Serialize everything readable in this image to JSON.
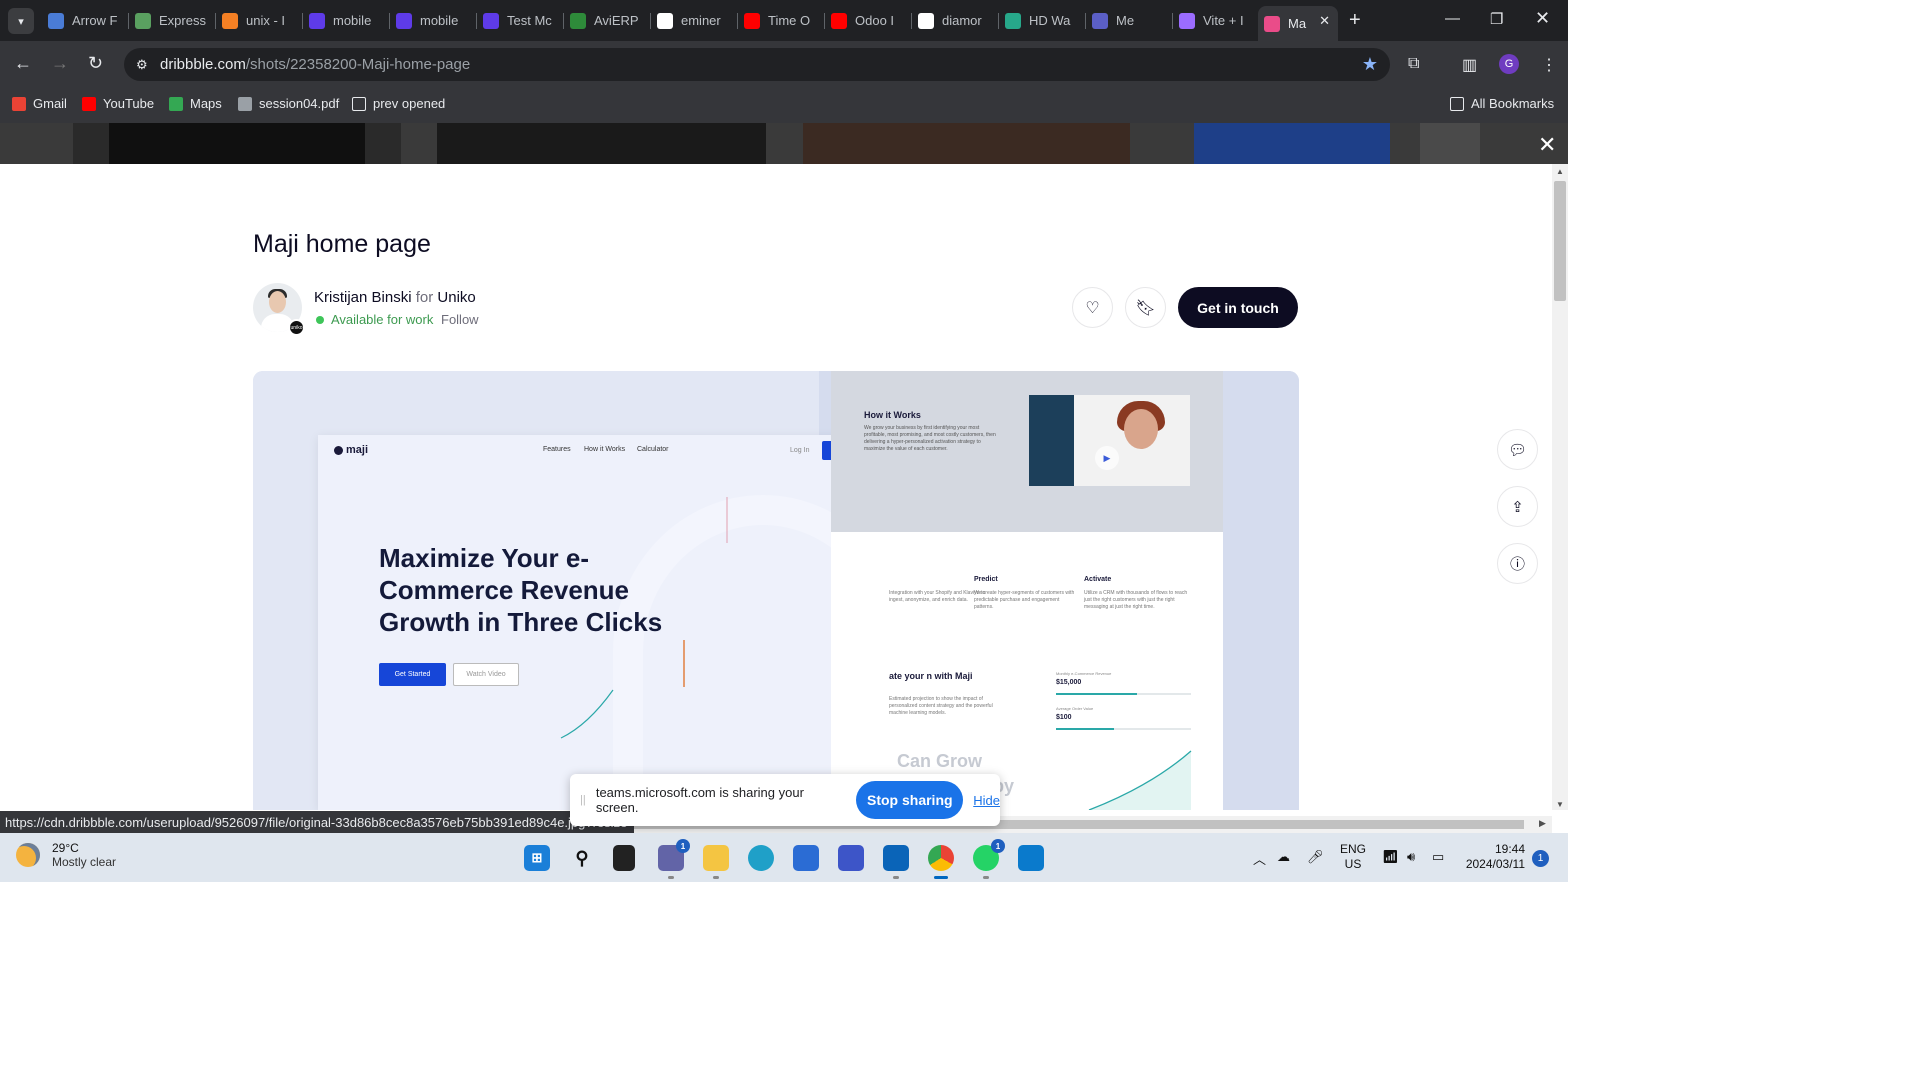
{
  "tabs": [
    {
      "title": "Arrow F",
      "color": "#4a7cd6"
    },
    {
      "title": "Express",
      "color": "#5aa060"
    },
    {
      "title": "unix - I",
      "color": "#f48024"
    },
    {
      "title": "mobile",
      "color": "#5e3be8"
    },
    {
      "title": "mobile",
      "color": "#5e3be8"
    },
    {
      "title": "Test Mc",
      "color": "#5e3be8"
    },
    {
      "title": "AviERP",
      "color": "#2e8b3a"
    },
    {
      "title": "eminer",
      "color": "#ffffff"
    },
    {
      "title": "Time O",
      "color": "#ff0000"
    },
    {
      "title": "Odoo I",
      "color": "#ff0000"
    },
    {
      "title": "diamor",
      "color": "#ffffff"
    },
    {
      "title": "HD Wa",
      "color": "#27a88a"
    },
    {
      "title": "Me",
      "color": "#5b5fc7"
    },
    {
      "title": "Vite + I",
      "color": "#9b6cff"
    },
    {
      "title": "Ma",
      "color": "#ea4c89"
    }
  ],
  "browser": {
    "url_host": "dribbble.com",
    "url_path": "/shots/22358200-Maji-home-page",
    "profile_initial": "G"
  },
  "bookmarks": [
    {
      "label": "Gmail",
      "color": "#ea4335"
    },
    {
      "label": "YouTube",
      "color": "#ff0000"
    },
    {
      "label": "Maps",
      "color": "#34a853"
    },
    {
      "label": "session04.pdf",
      "color": "#9aa0a6"
    },
    {
      "label": "prev opened",
      "color": "transparent"
    }
  ],
  "all_bookmarks": "All Bookmarks",
  "shot": {
    "title": "Maji home page",
    "author": "Kristijan Binski",
    "for_word": "for",
    "team": "Uniko",
    "availability": "Available for work",
    "follow": "Follow",
    "cta": "Get in touch",
    "avatar_badge": "uniko"
  },
  "mock": {
    "logo": "maji",
    "nav": [
      "Features",
      "How it Works",
      "Calculator"
    ],
    "login": "Log In",
    "get_started": "Get Started",
    "hero": "Maximize Your e-Commerce Revenue Growth in Three Clicks",
    "watch_video": "Watch Video",
    "how_title": "How it Works",
    "how_text": "We grow your business by first identifying your most profitable, most promising, and most costly customers, then delivering a hyper-personalized activation strategy to maximize the value of each customer.",
    "col1_text": "Integration with your Shopify and Klaviyo to ingest, anonymize, and enrich data.",
    "col2_title": "Predict",
    "col2_text": "We create hyper-segments of customers with predictable purchase and engagement patterns.",
    "col3_title": "Activate",
    "col3_text": "Utilize a CRM with thousands of flows to reach just the right customers with just the right messaging at just the right time.",
    "calc_title": "ate your n with Maji",
    "calc_text": "Estimated projection to show the impact of personalized content strategy and the powerful machine learning models.",
    "rev_label": "Monthly e-Commerce Revenue",
    "rev_value": "$15,000",
    "rev_fill": 0.6,
    "aov_label": "Average Order Value",
    "aov_value": "$100",
    "aov_fill": 0.43,
    "big1": "Can Grow",
    "big2": "by"
  },
  "status_url": "https://cdn.dribbble.com/userupload/9526097/file/original-33d86b8cec8a3576eb75bb391ed89c4e.jpg?resize=752x",
  "share_bar": {
    "message": "teams.microsoft.com is sharing your screen.",
    "stop": "Stop sharing",
    "hide": "Hide"
  },
  "taskbar": {
    "temp": "29°C",
    "weather": "Mostly clear",
    "lang1": "ENG",
    "lang2": "US",
    "time": "19:44",
    "date": "2024/03/11",
    "notifications": "1",
    "teams_badge": "1",
    "whatsapp_badge": "1"
  }
}
